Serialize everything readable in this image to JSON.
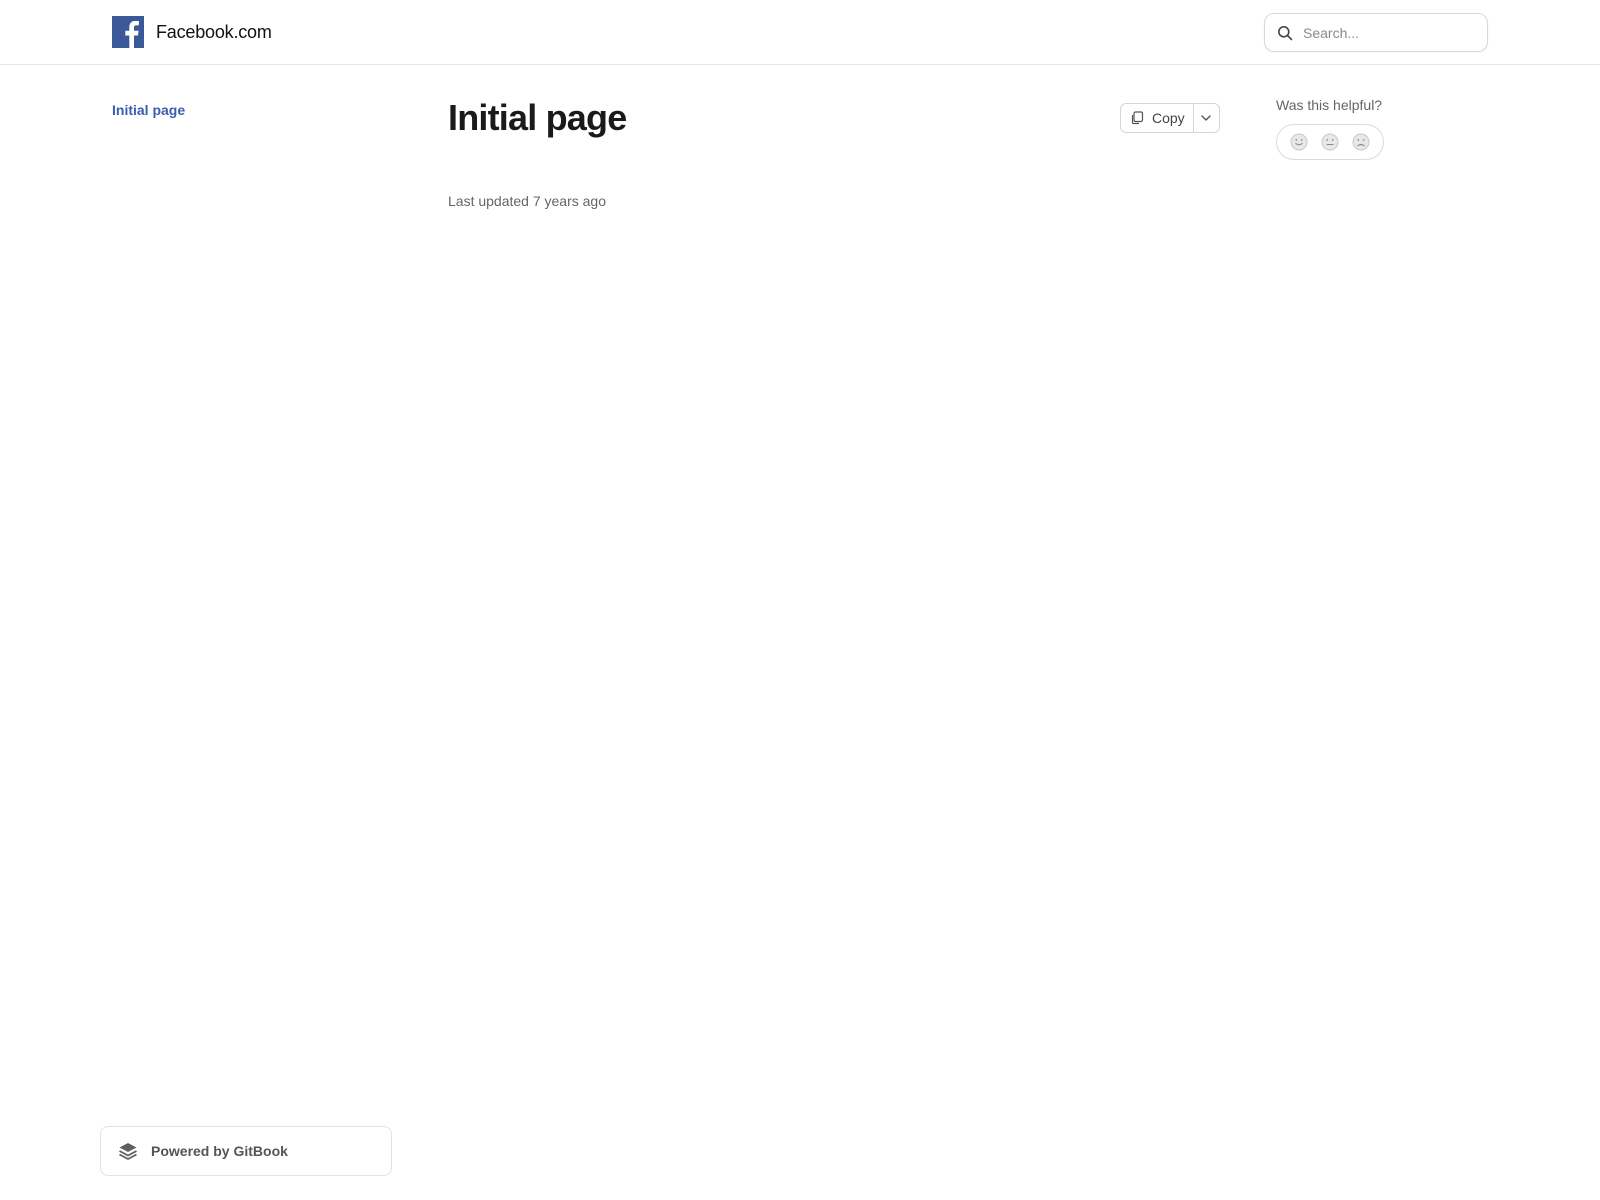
{
  "header": {
    "brand_name": "Facebook.com",
    "search_placeholder": "Search..."
  },
  "sidebar": {
    "items": [
      {
        "label": "Initial page",
        "active": true
      }
    ]
  },
  "main": {
    "title": "Initial page",
    "copy_label": "Copy",
    "last_updated": "Last updated 7 years ago"
  },
  "feedback": {
    "question": "Was this helpful?",
    "options": [
      "smile-icon",
      "neutral-face-icon",
      "frown-icon"
    ]
  },
  "footer": {
    "powered_by": "Powered by GitBook"
  },
  "colors": {
    "brand": "#3b5998",
    "link": "#3b5db0",
    "text": "#1a1a1a",
    "muted": "#666666",
    "border": "#e6e6e6"
  }
}
